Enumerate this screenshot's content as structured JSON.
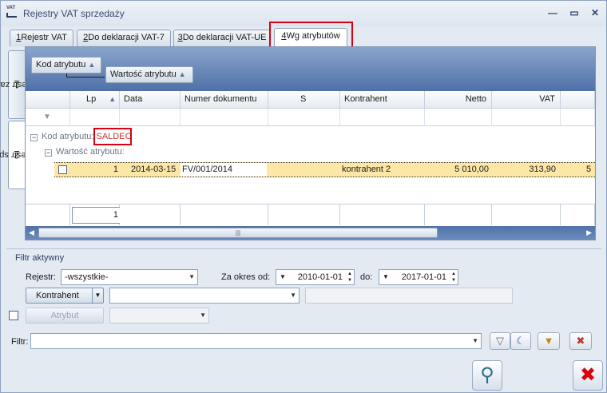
{
  "window": {
    "app_icon_text": "VAT",
    "title": "Rejestry VAT sprzedaży",
    "minimize_glyph": "—",
    "maximize_glyph": "▭",
    "close_glyph": "✕"
  },
  "tabs": [
    {
      "key": "1",
      "label": "Rejestr VAT"
    },
    {
      "key": "2",
      "label": "Do deklaracji VAT-7"
    },
    {
      "key": "3",
      "label": "Do deklaracji VAT-UE"
    },
    {
      "key": "4",
      "label": "Wg atrybutów"
    }
  ],
  "side_tabs": [
    {
      "key": "1",
      "label": "Rejestr zak."
    },
    {
      "key": "2",
      "label": "Rejestr spr."
    }
  ],
  "grid": {
    "group_chips": [
      "Kod atrybutu",
      "Wartość atrybutu"
    ],
    "sort_glyph": "▲",
    "columns": [
      "Lp",
      "Data",
      "Numer dokumentu",
      "S",
      "Kontrahent",
      "Netto",
      "VAT"
    ],
    "group1": {
      "label": "Kod atrybutu:",
      "value": "SALDEO"
    },
    "group2": {
      "label": "Wartość atrybutu:"
    },
    "rows": [
      {
        "lp": "1",
        "data": "2014-03-15",
        "numer": "FV/001/2014",
        "s": "",
        "kontrahent": "kontrahent 2",
        "netto": "5 010,00",
        "vat": "313,90",
        "extra": "5"
      }
    ],
    "footer_count": "1",
    "scroll_grip": "|||",
    "scroll_left": "◀",
    "scroll_right": "▶"
  },
  "filter": {
    "section_title": "Filtr aktywny",
    "rejestr_label": "Rejestr:",
    "rejestr_value": "-wszystkie-",
    "okres_label": "Za okres od:",
    "date_from": "2010-01-01",
    "do_label": "do:",
    "date_to": "2017-01-01",
    "kontrahent_button": "Kontrahent",
    "kontrahent_value": "",
    "atrybut_button": "Atrybut",
    "filtr_label": "Filtr:",
    "filtr_value": ""
  },
  "colors": {
    "highlight": "#d9000f",
    "selected_row": "#fde7a7",
    "group_value": "#c0392b"
  }
}
